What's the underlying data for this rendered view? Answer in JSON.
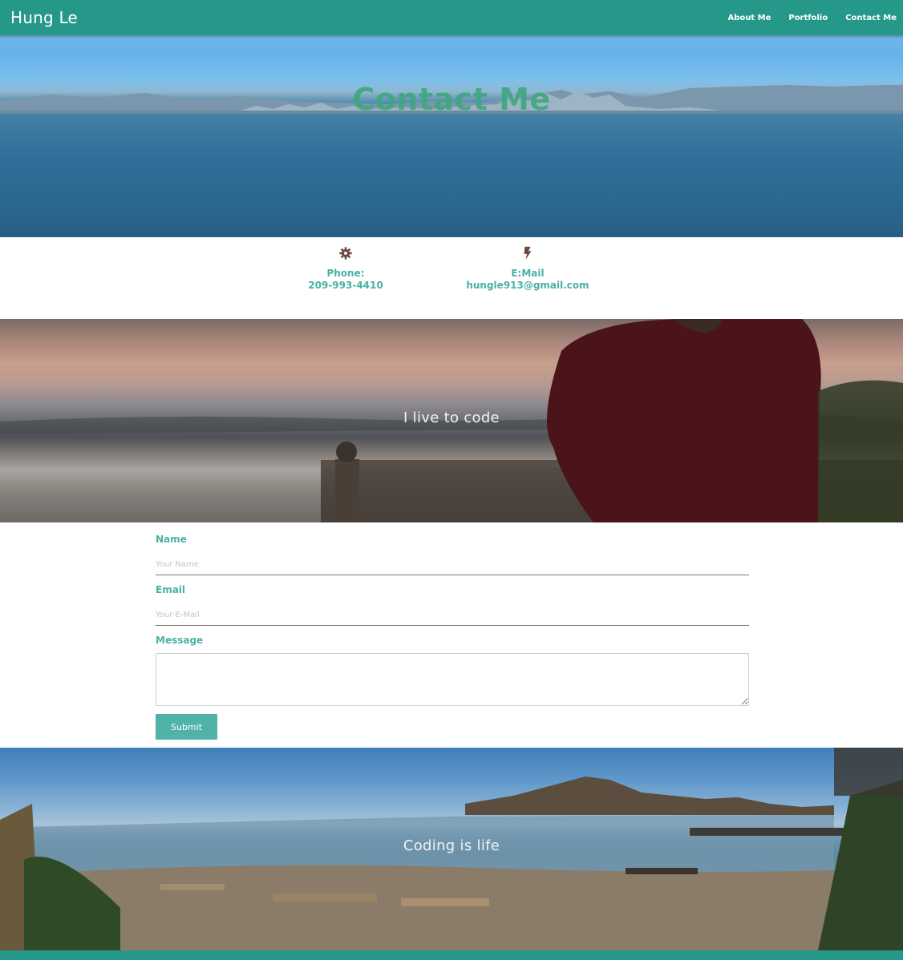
{
  "nav": {
    "brand": "Hung Le",
    "links": [
      {
        "label": "About Me"
      },
      {
        "label": "Portfolio"
      },
      {
        "label": "Contact Me"
      }
    ]
  },
  "hero": {
    "title": "Contact Me"
  },
  "contact": {
    "phone_label": "Phone:",
    "phone_value": "209-993-4410",
    "email_label": "E:Mail",
    "email_value": "hungle913@gmail.com",
    "icons": [
      "gear-icon",
      "bolt-icon"
    ]
  },
  "banner_1": {
    "text": "I live to code"
  },
  "form": {
    "name_label": "Name",
    "name_placeholder": "Your Name",
    "email_label": "Email",
    "email_placeholder": "Your E-Mail",
    "message_label": "Message",
    "submit_label": "Submit"
  },
  "banner_2": {
    "text": "Coding is life"
  },
  "colors": {
    "primary": "#26988a",
    "accent_text": "#4ab0a3",
    "button": "#50b3a8",
    "icon": "#6b4a3f"
  }
}
